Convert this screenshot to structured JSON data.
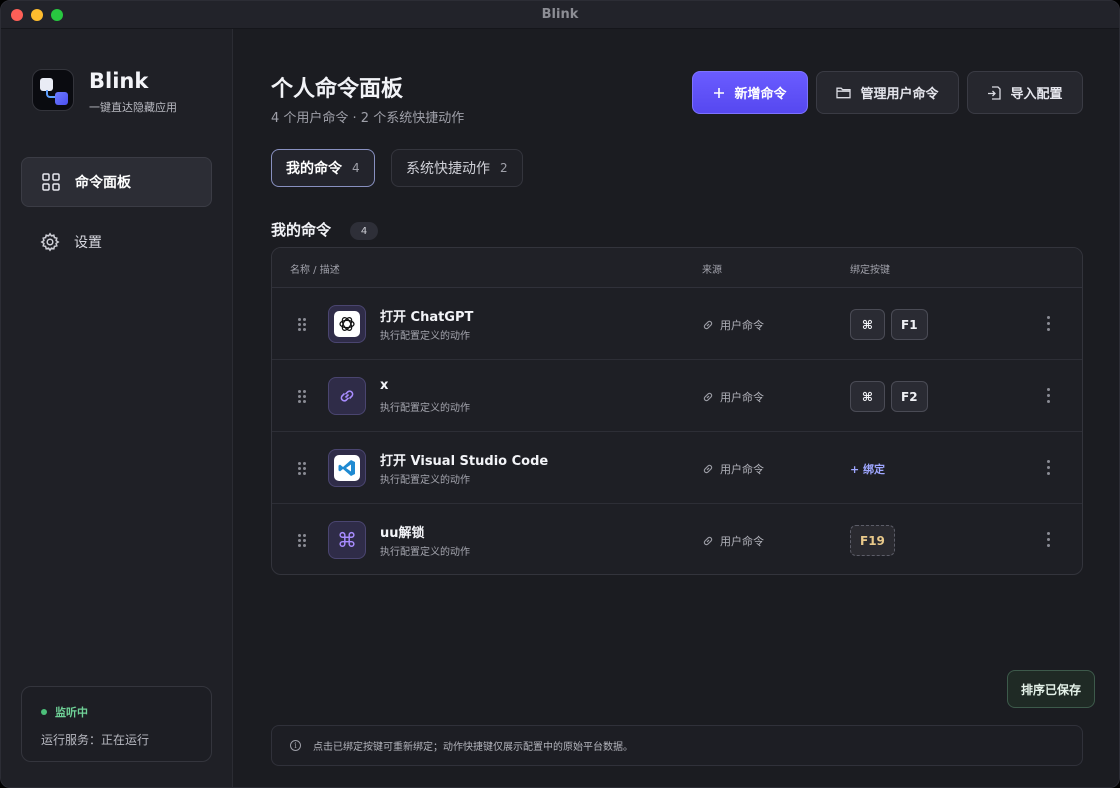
{
  "window": {
    "title": "Blink"
  },
  "brand": {
    "name": "Blink",
    "tagline": "一键直达隐藏应用"
  },
  "sidebar": {
    "items": [
      {
        "label": "命令面板",
        "icon": "grid-icon",
        "active": true
      },
      {
        "label": "设置",
        "icon": "gear-icon",
        "active": false
      }
    ],
    "status": {
      "label": "监听中",
      "service": "运行服务：正在运行",
      "color": "#4cc07a"
    }
  },
  "header": {
    "title": "个人命令面板",
    "subtitle": "4 个用户命令 · 2 个系统快捷动作",
    "buttons": {
      "add": "新增命令",
      "manage": "管理用户命令",
      "import": "导入配置"
    }
  },
  "tabs": [
    {
      "label": "我的命令",
      "count": "4",
      "active": true
    },
    {
      "label": "系统快捷动作",
      "count": "2",
      "active": false
    }
  ],
  "section": {
    "title": "我的命令",
    "count": "4"
  },
  "table": {
    "headers": {
      "name": "名称 / 描述",
      "source": "来源",
      "binding": "绑定按键"
    },
    "rows": [
      {
        "name": "打开 ChatGPT",
        "desc": "执行配置定义的动作",
        "icon": "chatgpt-icon",
        "source": "用户命令",
        "keys": [
          "⌘",
          "F1"
        ]
      },
      {
        "name": "x",
        "desc": "执行配置定义的动作",
        "icon": "link-icon",
        "source": "用户命令",
        "keys": [
          "⌘",
          "F2"
        ]
      },
      {
        "name": "打开 Visual Studio Code",
        "desc": "执行配置定义的动作",
        "icon": "vscode-icon",
        "source": "用户命令",
        "bind_label": "+ 绑定"
      },
      {
        "name": "uu解锁",
        "desc": "执行配置定义的动作",
        "icon": "command-icon",
        "source": "用户命令",
        "keys": [
          "F19"
        ]
      }
    ]
  },
  "toast": {
    "text": "排序已保存"
  },
  "hint": {
    "text": "点击已绑定按键可重新绑定；动作快捷键仅展示配置中的原始平台数据。"
  },
  "colors": {
    "accent": "#5d50f5",
    "background": "#1b1c21",
    "sidebar": "#1f2026"
  }
}
